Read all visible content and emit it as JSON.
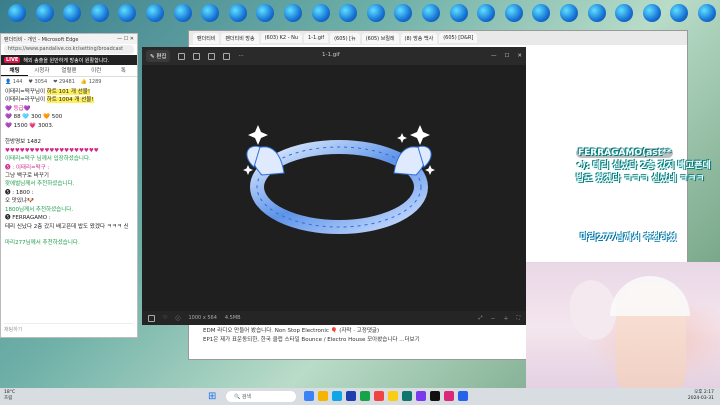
{
  "desktop_icons": [
    "",
    "",
    "",
    "",
    "",
    "",
    "",
    "",
    "",
    "",
    "",
    "",
    "",
    "",
    "",
    "",
    "",
    "",
    "",
    "",
    "",
    "",
    "",
    "",
    "",
    ""
  ],
  "chat_window": {
    "title": "팬더티비 - 개인 - Microsoft Edge",
    "url": "https://www.pandalive.co.kr/setting/broadcast",
    "live_badge": "LIVE",
    "live_text": "해외 송출을 원만하게 방송이 원활합니다.",
    "tabs": [
      "채팅",
      "시청자",
      "열혈팬",
      "이런",
      "톡"
    ],
    "stats": [
      "144",
      "3054",
      "29481",
      "1289"
    ],
    "messages": [
      {
        "prefix": "",
        "name": "이태리=떡꾸님이 ",
        "hl": "하트 101 개 선물!",
        "suffix": "",
        "style": "hl"
      },
      {
        "prefix": "",
        "name": "이태리=라꾸님이 ",
        "hl": "하트 1004 개 선물!",
        "suffix": "",
        "style": "hl"
      },
      {
        "prefix": "",
        "name": "💜 등급💜",
        "hl": "",
        "suffix": "",
        "style": "pink"
      },
      {
        "prefix": "",
        "name": "💜 88  🩵 300  🧡 500",
        "hl": "",
        "suffix": "",
        "style": ""
      },
      {
        "prefix": "",
        "name": "   💜 1500  💗 3003.",
        "hl": "",
        "suffix": "",
        "style": ""
      },
      {
        "prefix": "",
        "name": "",
        "hl": "",
        "suffix": "",
        "style": ""
      },
      {
        "prefix": "",
        "name": "한방명보 1482",
        "hl": "",
        "suffix": "",
        "style": ""
      },
      {
        "prefix": "",
        "name": "♥♥♥♥♥♥♥♥♥♥♥♥♥♥♥♥♥♥♥",
        "hl": "",
        "suffix": "",
        "style": "pink"
      },
      {
        "prefix": "",
        "name": "이태리=떡구 님께서 입장하셨습니다.",
        "hl": "",
        "suffix": "",
        "style": "green"
      },
      {
        "prefix": "",
        "name": "🅢 : 이태리=떡구 :",
        "hl": "",
        "suffix": "",
        "style": "pink"
      },
      {
        "prefix": "",
        "name": "그냥 백구로 바꾸기",
        "hl": "",
        "suffix": "",
        "style": ""
      },
      {
        "prefix": "",
        "name": "왓에벌님께서 추천하셨습니다.",
        "hl": "",
        "suffix": "",
        "style": "green"
      },
      {
        "prefix": "",
        "name": "🅢 : 1800 :",
        "hl": "",
        "suffix": "",
        "style": ""
      },
      {
        "prefix": "",
        "name": "오 맛있냐🐶",
        "hl": "",
        "suffix": "",
        "style": ""
      },
      {
        "prefix": "",
        "name": "1800님께서 추천하셨습니다.",
        "hl": "",
        "suffix": "",
        "style": "green"
      },
      {
        "prefix": "",
        "name": "🅢 FERRAGAMO :",
        "hl": "",
        "suffix": "",
        "style": ""
      },
      {
        "prefix": "",
        "name": "테리 신났다 2층 갔지 배고픈데 밥도 왔겠다 ㅋㅋㅋ 신",
        "hl": "",
        "suffix": "",
        "style": ""
      },
      {
        "prefix": "",
        "name": "",
        "hl": "",
        "suffix": "",
        "style": ""
      },
      {
        "prefix": "",
        "name": "마리277님께서 추천하셨습니다.",
        "hl": "",
        "suffix": "",
        "style": "green"
      }
    ],
    "input_placeholder": "채팅하기"
  },
  "viewer": {
    "edit_label": "편집",
    "filename": "1-1.gif",
    "dimensions": "1000 x 564",
    "filesize": "4.5MB"
  },
  "bg_browser": {
    "tabs": [
      "팬더티비",
      "팬더티비 방송",
      "(603) K2 - Nu",
      "1-1.gif",
      "(605) [뉴",
      "(605) 브릴레",
      "(8) 방송 백사",
      "(605) [D&R]"
    ],
    "desc_line1": "EDM 라디오 만들어 봤습니다.  Non Stop Electronic 🎈 (자막 · 고정댓글)",
    "desc_line2": "EP1은 제가 표운동되한, 한국 클럽 스타일 Bounce / Electro House 모아봤습니다 ...더보기"
  },
  "overlay": {
    "name": "FERRAGAMO(ast**",
    "text": "•):  테리 신났다 2층 갔지 배고픈데 밥도 왔겠다 ㅋㅋㅋ 신났네 ㅋㅋㅋ",
    "donation": "마리277님께서 추천하셨"
  },
  "taskbar": {
    "weather_temp": "18°C",
    "weather_desc": "흐림",
    "search_placeholder": "검색",
    "time": "오후 2:17",
    "date": "2024-03-31"
  },
  "colors": {
    "accent": "#e0174c",
    "chat_green": "#1c9c4a",
    "ring_blue": "#2f6fd8"
  }
}
